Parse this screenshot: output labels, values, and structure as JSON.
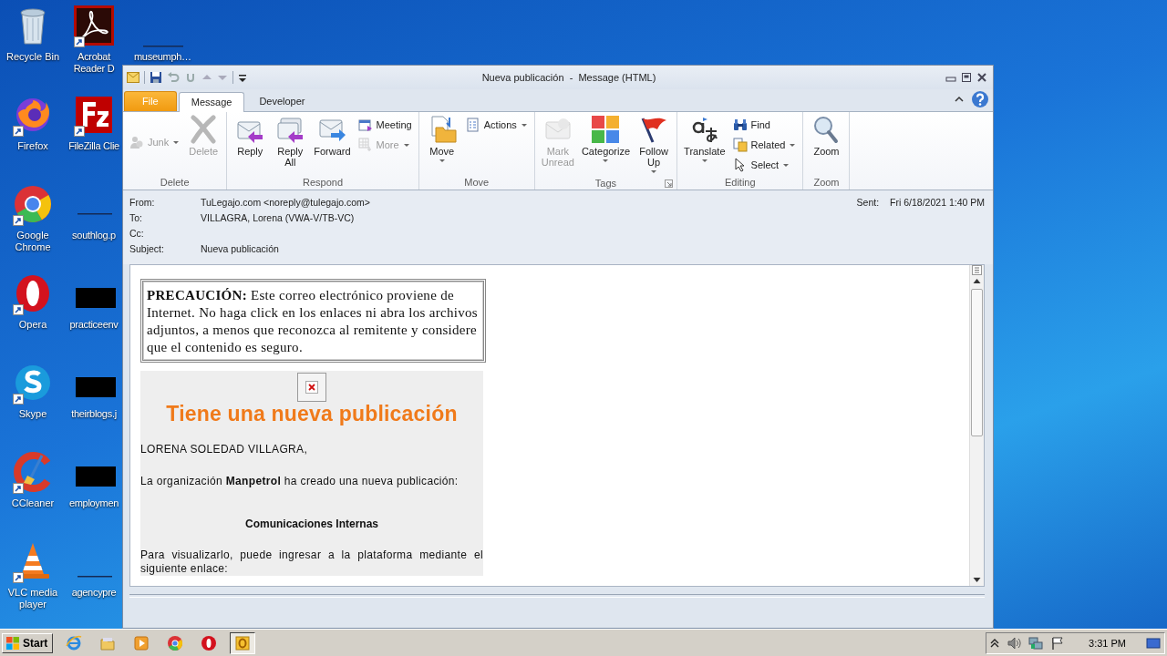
{
  "desktop_icons": [
    {
      "label": "Recycle Bin",
      "shortcut": false
    },
    {
      "label": "Firefox",
      "shortcut": true
    },
    {
      "label": "Google Chrome",
      "shortcut": true
    },
    {
      "label": "Opera",
      "shortcut": true
    },
    {
      "label": "Skype",
      "shortcut": true
    },
    {
      "label": "CCleaner",
      "shortcut": true
    },
    {
      "label": "VLC media player",
      "shortcut": true
    },
    {
      "label": "Acrobat Reader D",
      "shortcut": true
    },
    {
      "label": "FileZilla Clie",
      "shortcut": true
    },
    {
      "label": "southlog.p",
      "shortcut": false
    },
    {
      "label": "practiceenv",
      "shortcut": false
    },
    {
      "label": "theirblogs.j",
      "shortcut": false
    },
    {
      "label": "employmen",
      "shortcut": false
    },
    {
      "label": "agencypre",
      "shortcut": false
    },
    {
      "label": "museumph…",
      "shortcut": false
    }
  ],
  "window": {
    "title": "Nueva publicación  -  Message (HTML)",
    "tabs": [
      {
        "label": "File",
        "kind": "file",
        "selected": false
      },
      {
        "label": "Message",
        "kind": "plain",
        "selected": true
      },
      {
        "label": "Developer",
        "kind": "plain",
        "selected": false
      }
    ],
    "ribbon_groups": [
      {
        "label": "Delete",
        "launcher": false,
        "items": [
          {
            "label": "Junk",
            "kind": "small",
            "disabled": true,
            "dropdown": true
          },
          {
            "label": "Delete",
            "kind": "large",
            "disabled": true,
            "dropdown": false
          }
        ]
      },
      {
        "label": "Respond",
        "launcher": false,
        "items": [
          {
            "label": "Reply",
            "kind": "large",
            "disabled": false,
            "dropdown": false
          },
          {
            "label": "Reply All",
            "kind": "large",
            "disabled": false,
            "dropdown": false
          },
          {
            "label": "Forward",
            "kind": "large",
            "disabled": false,
            "dropdown": false
          },
          {
            "label": "Meeting",
            "kind": "small",
            "disabled": false,
            "dropdown": false
          },
          {
            "label": "More",
            "kind": "small",
            "disabled": true,
            "dropdown": true
          }
        ]
      },
      {
        "label": "Move",
        "launcher": false,
        "items": [
          {
            "label": "Move",
            "kind": "large",
            "disabled": false,
            "dropdown": true
          },
          {
            "label": "Actions",
            "kind": "small",
            "disabled": false,
            "dropdown": true
          }
        ]
      },
      {
        "label": "Tags",
        "launcher": true,
        "items": [
          {
            "label": "Mark Unread",
            "kind": "large",
            "disabled": true,
            "dropdown": false
          },
          {
            "label": "Categorize",
            "kind": "large",
            "disabled": false,
            "dropdown": true
          },
          {
            "label": "Follow Up",
            "kind": "large",
            "disabled": false,
            "dropdown": true
          }
        ]
      },
      {
        "label": "Editing",
        "launcher": false,
        "items": [
          {
            "label": "Translate",
            "kind": "large",
            "disabled": false,
            "dropdown": true
          },
          {
            "label": "Find",
            "kind": "small",
            "disabled": false,
            "dropdown": false
          },
          {
            "label": "Related",
            "kind": "small",
            "disabled": false,
            "dropdown": true
          },
          {
            "label": "Select",
            "kind": "small",
            "disabled": false,
            "dropdown": true
          }
        ]
      },
      {
        "label": "Zoom",
        "launcher": false,
        "items": [
          {
            "label": "Zoom",
            "kind": "large",
            "disabled": false,
            "dropdown": false
          }
        ]
      }
    ]
  },
  "message": {
    "fields": [
      {
        "label": "From:",
        "value": "TuLegajo.com <noreply@tulegajo.com>"
      },
      {
        "label": "To:",
        "value": "VILLAGRA, Lorena (VWA-V/TB-VC)"
      },
      {
        "label": "Cc:"
      },
      {
        "label": "Subject:",
        "value": "Nueva publicación"
      }
    ],
    "sent": {
      "label": "Sent:",
      "value": "Fri 6/18/2021 1:40 PM"
    },
    "warning": "**PRECAUCIÓN:** Este correo electrónico proviene de Internet. No haga click en los enlaces ni abra los archivos adjuntos, a menos que reconozca al remitente y considere que el contenido es seguro.",
    "heading": "Tiene una nueva publicación",
    "greeting": "LORENA SOLEDAD VILLAGRA,",
    "intro": "La organización **Manpetrol** ha creado una nueva publicación:",
    "subheading": "Comunicaciones Internas",
    "instructions": "Para visualizarlo, puede ingresar a la plataforma mediante el siguiente enlace:"
  },
  "taskbar": {
    "start": "Start",
    "apps": [
      {
        "active": false
      },
      {
        "active": false
      },
      {
        "active": false
      },
      {
        "active": false
      },
      {
        "active": false
      },
      {
        "active": true
      }
    ],
    "clock": "3:31 PM"
  }
}
